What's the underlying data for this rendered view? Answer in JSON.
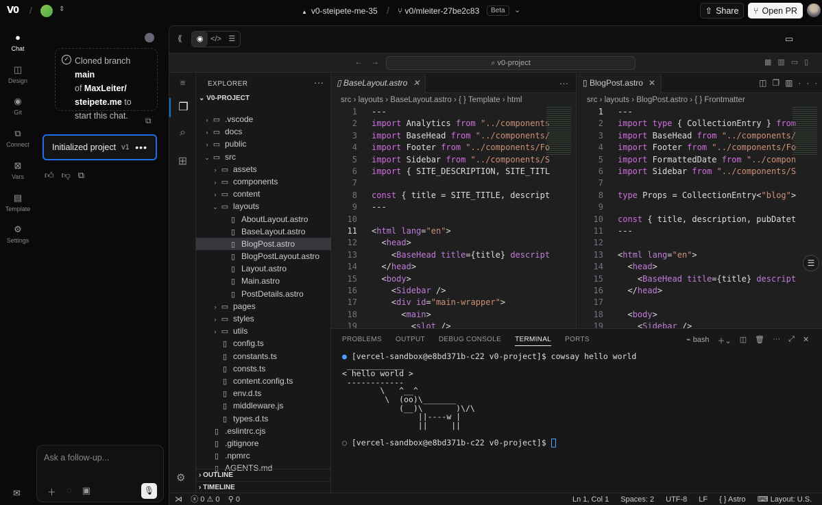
{
  "topbar": {
    "logo": "V0",
    "project": "v0-steipete-me-35",
    "branch": "v0/mleiter-27be2c83",
    "beta": "Beta",
    "share_label": "Share",
    "open_pr_label": "Open PR"
  },
  "nav": [
    {
      "label": "Chat",
      "icon": "chat-icon"
    },
    {
      "label": "Design",
      "icon": "design-icon"
    },
    {
      "label": "Git",
      "icon": "git-icon"
    },
    {
      "label": "Connect",
      "icon": "connect-icon"
    },
    {
      "label": "Vars",
      "icon": "vars-icon"
    },
    {
      "label": "Template",
      "icon": "template-icon"
    },
    {
      "label": "Settings",
      "icon": "gear-icon"
    }
  ],
  "chat": {
    "clone_prefix": "Cloned branch",
    "clone_branch": "main",
    "clone_of": "of",
    "clone_repo": "MaxLeiter/ steipete.me",
    "clone_suffix": "to start this chat.",
    "version_label": "Initialized project",
    "version_tag": "v1",
    "followup_placeholder": "Ask a follow-up..."
  },
  "editor": {
    "search": "v0-project",
    "explorer_title": "EXPLORER",
    "project_root": "V0-PROJECT",
    "tree": [
      {
        "name": ".vscode",
        "type": "folder",
        "depth": 0,
        "open": false
      },
      {
        "name": "docs",
        "type": "folder",
        "depth": 0,
        "open": false
      },
      {
        "name": "public",
        "type": "folder",
        "depth": 0,
        "open": false
      },
      {
        "name": "src",
        "type": "folder",
        "depth": 0,
        "open": true
      },
      {
        "name": "assets",
        "type": "folder",
        "depth": 1,
        "open": false
      },
      {
        "name": "components",
        "type": "folder",
        "depth": 1,
        "open": false
      },
      {
        "name": "content",
        "type": "folder",
        "depth": 1,
        "open": false
      },
      {
        "name": "layouts",
        "type": "folder",
        "depth": 1,
        "open": true
      },
      {
        "name": "AboutLayout.astro",
        "type": "file",
        "depth": 2
      },
      {
        "name": "BaseLayout.astro",
        "type": "file",
        "depth": 2
      },
      {
        "name": "BlogPost.astro",
        "type": "file",
        "depth": 2,
        "selected": true
      },
      {
        "name": "BlogPostLayout.astro",
        "type": "file",
        "depth": 2
      },
      {
        "name": "Layout.astro",
        "type": "file",
        "depth": 2
      },
      {
        "name": "Main.astro",
        "type": "file",
        "depth": 2
      },
      {
        "name": "PostDetails.astro",
        "type": "file",
        "depth": 2
      },
      {
        "name": "pages",
        "type": "folder",
        "depth": 1,
        "open": false
      },
      {
        "name": "styles",
        "type": "folder",
        "depth": 1,
        "open": false
      },
      {
        "name": "utils",
        "type": "folder",
        "depth": 1,
        "open": false
      },
      {
        "name": "config.ts",
        "type": "file",
        "depth": 1
      },
      {
        "name": "constants.ts",
        "type": "file",
        "depth": 1
      },
      {
        "name": "consts.ts",
        "type": "file",
        "depth": 1
      },
      {
        "name": "content.config.ts",
        "type": "file",
        "depth": 1
      },
      {
        "name": "env.d.ts",
        "type": "file",
        "depth": 1
      },
      {
        "name": "middleware.js",
        "type": "file",
        "depth": 1
      },
      {
        "name": "types.d.ts",
        "type": "file",
        "depth": 1
      },
      {
        "name": ".eslintrc.cjs",
        "type": "file",
        "depth": 0
      },
      {
        "name": ".gitignore",
        "type": "file",
        "depth": 0
      },
      {
        "name": ".npmrc",
        "type": "file",
        "depth": 0
      },
      {
        "name": "AGENTS.md",
        "type": "file",
        "depth": 0
      }
    ],
    "outline": "OUTLINE",
    "timeline": "TIMELINE",
    "left_tab": "BaseLayout.astro",
    "left_crumb": [
      "src",
      "layouts",
      "BaseLayout.astro",
      "{ } Template",
      "html"
    ],
    "right_tab": "BlogPost.astro",
    "right_crumb": [
      "src",
      "layouts",
      "BlogPost.astro",
      "{ } Frontmatter"
    ],
    "panel_tabs": [
      "PROBLEMS",
      "OUTPUT",
      "DEBUG CONSOLE",
      "TERMINAL",
      "PORTS"
    ],
    "shell": "bash",
    "terminal_prompt1": "[vercel-sandbox@e8bd371b-c22 v0-project]$ cowsay hello world",
    "cowsay": " ____________\n< hello world >\n ------------\n        \\   ^__^\n         \\  (oo)\\_______\n            (__)\\       )\\/\\\n                ||----w |\n                ||     ||",
    "terminal_prompt2": "[vercel-sandbox@e8bd371b-c22 v0-project]$ ",
    "status": {
      "errors": "0",
      "warnings": "0",
      "ports": "0",
      "position": "Ln 1, Col 1",
      "spaces": "Spaces: 2",
      "encoding": "UTF-8",
      "eol": "LF",
      "lang": "Astro",
      "layout": "Layout: U.S."
    }
  }
}
